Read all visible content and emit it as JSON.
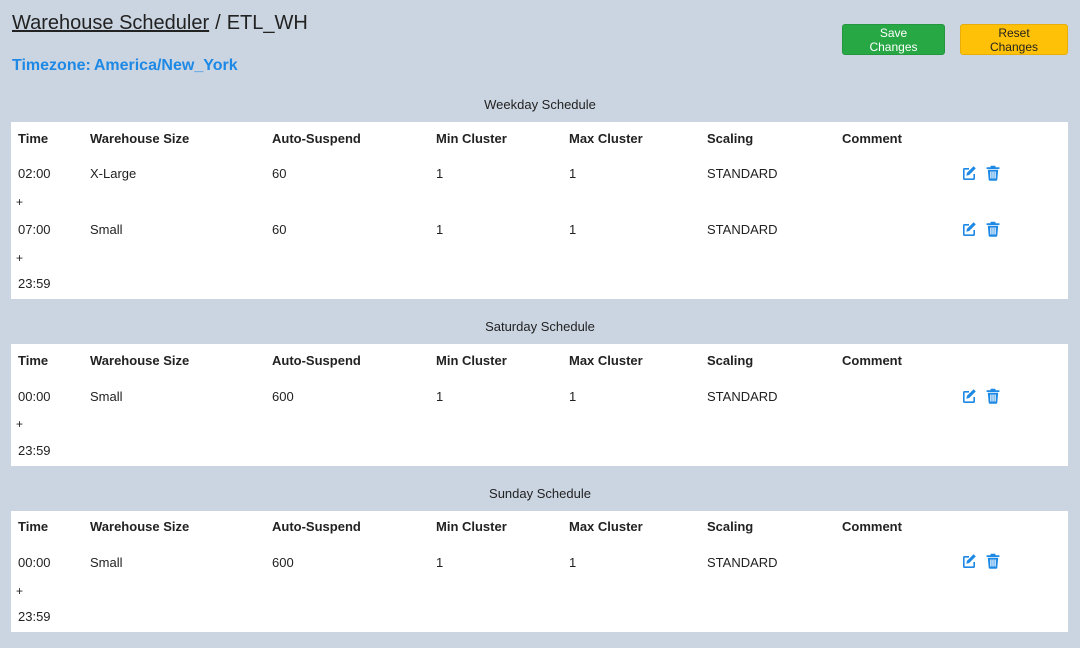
{
  "header": {
    "title_link": "Warehouse Scheduler",
    "separator": "/",
    "warehouse": "ETL_WH"
  },
  "timezone": {
    "label": "Timezone:",
    "value": "America/New_York"
  },
  "buttons": {
    "save": "Save Changes",
    "reset": "Reset Changes"
  },
  "colors": {
    "background": "#cbd5e1",
    "save": "#28a745",
    "reset": "#ffc107",
    "accent": "#1e88e5"
  },
  "columns": [
    "Time",
    "Warehouse Size",
    "Auto-Suspend",
    "Min Cluster",
    "Max Cluster",
    "Scaling",
    "Comment"
  ],
  "schedules": [
    {
      "title": "Weekday Schedule",
      "rows": [
        {
          "time": "02:00",
          "size": "X-Large",
          "suspend": "60",
          "min": "1",
          "max": "1",
          "scaling": "STANDARD",
          "comment": ""
        },
        {
          "time": "07:00",
          "size": "Small",
          "suspend": "60",
          "min": "1",
          "max": "1",
          "scaling": "STANDARD",
          "comment": ""
        }
      ],
      "add": "+",
      "end": "23:59"
    },
    {
      "title": "Saturday Schedule",
      "rows": [
        {
          "time": "00:00",
          "size": "Small",
          "suspend": "600",
          "min": "1",
          "max": "1",
          "scaling": "STANDARD",
          "comment": ""
        }
      ],
      "add": "+",
      "end": "23:59"
    },
    {
      "title": "Sunday Schedule",
      "rows": [
        {
          "time": "00:00",
          "size": "Small",
          "suspend": "600",
          "min": "1",
          "max": "1",
          "scaling": "STANDARD",
          "comment": ""
        }
      ],
      "add": "+",
      "end": "23:59"
    }
  ],
  "icons": {
    "edit": "edit-icon",
    "delete": "trash-icon"
  }
}
